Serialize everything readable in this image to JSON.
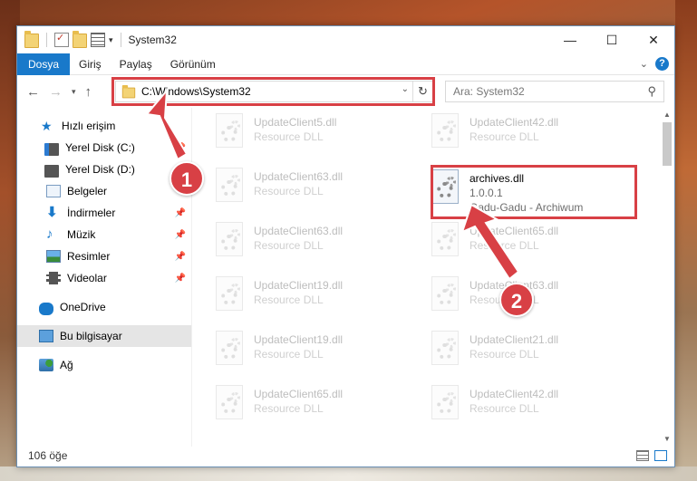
{
  "window": {
    "title": "System32",
    "controls": {
      "minimize": "—",
      "maximize": "☐",
      "close": "✕"
    }
  },
  "ribbon": {
    "tabs": [
      {
        "label": "Dosya",
        "active": true
      },
      {
        "label": "Giriş"
      },
      {
        "label": "Paylaş"
      },
      {
        "label": "Görünüm"
      }
    ],
    "help": "?"
  },
  "address": {
    "path": "C:\\Windows\\System32",
    "search_placeholder": "Ara: System32"
  },
  "sidebar": {
    "items": [
      {
        "label": "Hızlı erişim",
        "icon": "star-icon"
      },
      {
        "label": "Yerel Disk (C:)",
        "icon": "disk-icon",
        "pinned": true
      },
      {
        "label": "Yerel Disk (D:)",
        "icon": "disk-icon"
      },
      {
        "label": "Belgeler",
        "icon": "documents-icon"
      },
      {
        "label": "İndirmeler",
        "icon": "download-icon",
        "pinned": true
      },
      {
        "label": "Müzik",
        "icon": "music-icon",
        "pinned": true
      },
      {
        "label": "Resimler",
        "icon": "pictures-icon",
        "pinned": true
      },
      {
        "label": "Videolar",
        "icon": "videos-icon",
        "pinned": true
      },
      {
        "label": "OneDrive",
        "icon": "onedrive-icon"
      },
      {
        "label": "Bu bilgisayar",
        "icon": "this-pc-icon",
        "selected": true
      },
      {
        "label": "Ağ",
        "icon": "network-icon"
      }
    ]
  },
  "files": {
    "left": [
      {
        "name": "UpdateClient5.dll",
        "desc": "Resource DLL"
      },
      {
        "name": "UpdateClient63.dll",
        "desc": "Resource DLL"
      },
      {
        "name": "UpdateClient63.dll",
        "desc": "Resource DLL"
      },
      {
        "name": "UpdateClient19.dll",
        "desc": "Resource DLL"
      },
      {
        "name": "UpdateClient19.dll",
        "desc": "Resource DLL"
      },
      {
        "name": "UpdateClient65.dll",
        "desc": "Resource DLL"
      }
    ],
    "right": [
      {
        "name": "UpdateClient42.dll",
        "desc": "Resource DLL"
      },
      {
        "name": "archives.dll",
        "version": "1.0.0.1",
        "desc": "Gadu-Gadu - Archiwum",
        "highlighted": true
      },
      {
        "name": "UpdateClient65.dll",
        "desc": "Resource DLL"
      },
      {
        "name": "UpdateClient63.dll",
        "desc": "Resource DLL"
      },
      {
        "name": "UpdateClient21.dll",
        "desc": "Resource DLL"
      },
      {
        "name": "UpdateClient42.dll",
        "desc": "Resource DLL"
      }
    ]
  },
  "status": {
    "count": "106 öğe"
  },
  "annotations": {
    "step1": "1",
    "step2": "2",
    "color": "#d84045"
  }
}
